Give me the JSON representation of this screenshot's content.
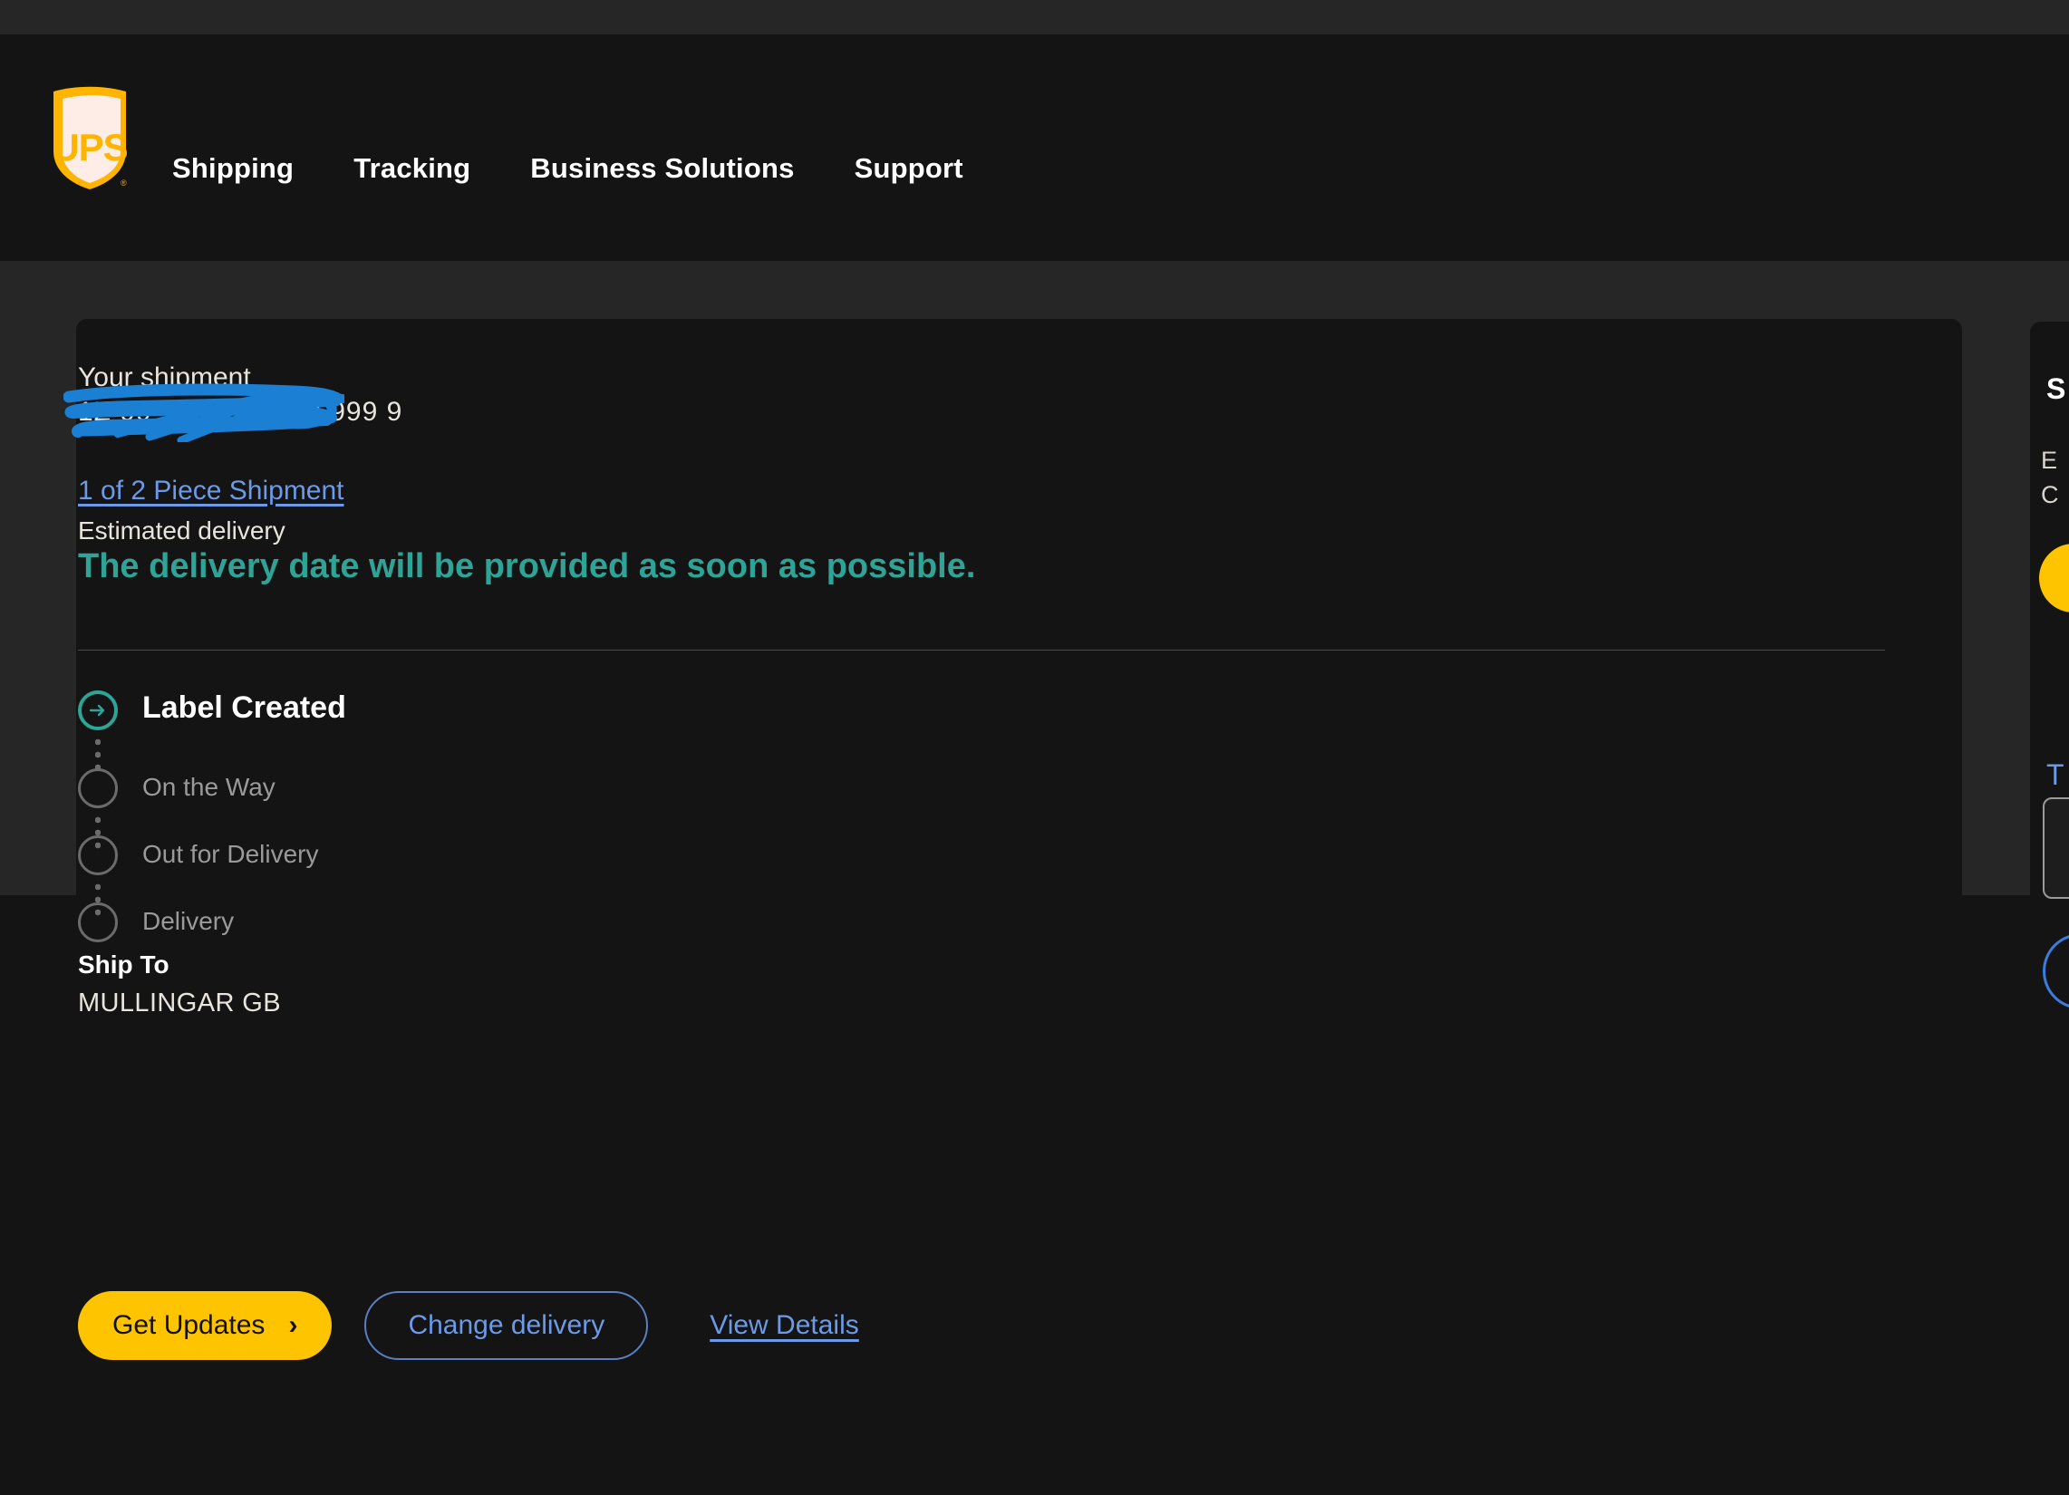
{
  "header": {
    "logo_alt": "UPS",
    "nav": [
      {
        "label": "Shipping"
      },
      {
        "label": "Tracking"
      },
      {
        "label": "Business Solutions"
      },
      {
        "label": "Support"
      }
    ]
  },
  "shipment": {
    "your_shipment_label": "Your shipment",
    "tracking_number": "1Z 99 999 99 9999 999 9",
    "tracking_number_redacted": true,
    "piece_link": "1 of 2 Piece Shipment",
    "estimated_delivery_label": "Estimated delivery",
    "delivery_message": "The delivery date will be provided as soon as possible.",
    "timeline": [
      {
        "label": "Label Created",
        "state": "active"
      },
      {
        "label": "On the Way",
        "state": "pending"
      },
      {
        "label": "Out for Delivery",
        "state": "pending"
      },
      {
        "label": "Delivery",
        "state": "pending"
      }
    ],
    "ship_to_label": "Ship To",
    "ship_to_value": "MULLINGAR GB",
    "actions": {
      "get_updates": "Get Updates",
      "get_updates_chevron": "›",
      "change_delivery": "Change delivery",
      "view_details": "View Details"
    }
  },
  "side_panels": [
    {
      "title_fragment": "S",
      "line1_fragment": "E",
      "line2_fragment": "C"
    },
    {
      "title_fragment": "T"
    }
  ],
  "colors": {
    "page_bg": "#141414",
    "body_bg": "#262626",
    "card_bg": "#141414",
    "brand_yellow": "#FFC400",
    "teal_accent": "#2fa395",
    "link_blue": "#6b9ae8",
    "redaction_blue": "#1B7FD4",
    "muted_text": "#9a9a9a"
  }
}
